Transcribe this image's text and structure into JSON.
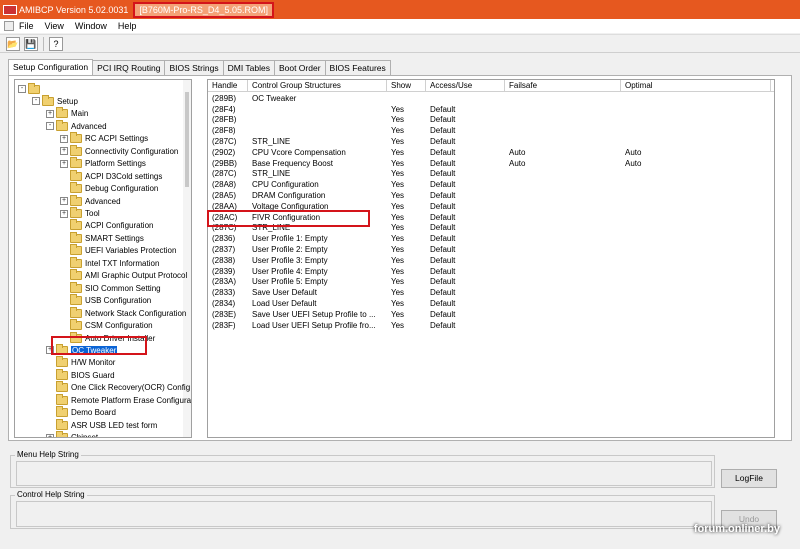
{
  "window": {
    "title": "AMIBCP Version 5.02.0031",
    "file": "[B760M-Pro-RS_D4_5.05.ROM]"
  },
  "menu": [
    "File",
    "View",
    "Window",
    "Help"
  ],
  "toolbar": {
    "icons": [
      "open-icon",
      "save-icon",
      "help-icon"
    ]
  },
  "tabs": [
    "Setup Configuration",
    "PCI IRQ Routing",
    "BIOS Strings",
    "DMI Tables",
    "Boot Order",
    "BIOS Features"
  ],
  "tree": [
    {
      "label": "",
      "level": 0,
      "expander": "-"
    },
    {
      "label": "Setup",
      "level": 1,
      "expander": "-"
    },
    {
      "label": "Main",
      "level": 2,
      "expander": "+"
    },
    {
      "label": "Advanced",
      "level": 2,
      "expander": "-"
    },
    {
      "label": "RC ACPI Settings",
      "level": 3,
      "expander": "+"
    },
    {
      "label": "Connectivity Configuration",
      "level": 3,
      "expander": "+"
    },
    {
      "label": "Platform Settings",
      "level": 3,
      "expander": "+"
    },
    {
      "label": "ACPI D3Cold settings",
      "level": 3,
      "expander": ""
    },
    {
      "label": "Debug Configuration",
      "level": 3,
      "expander": ""
    },
    {
      "label": "Advanced",
      "level": 3,
      "expander": "+"
    },
    {
      "label": "Tool",
      "level": 3,
      "expander": "+"
    },
    {
      "label": "ACPI Configuration",
      "level": 3,
      "expander": ""
    },
    {
      "label": "SMART Settings",
      "level": 3,
      "expander": ""
    },
    {
      "label": "UEFI Variables Protection",
      "level": 3,
      "expander": ""
    },
    {
      "label": "Intel TXT Information",
      "level": 3,
      "expander": ""
    },
    {
      "label": "AMI Graphic Output Protocol",
      "level": 3,
      "expander": ""
    },
    {
      "label": "SIO Common Setting",
      "level": 3,
      "expander": ""
    },
    {
      "label": "USB Configuration",
      "level": 3,
      "expander": ""
    },
    {
      "label": "Network Stack Configuration",
      "level": 3,
      "expander": ""
    },
    {
      "label": "CSM Configuration",
      "level": 3,
      "expander": ""
    },
    {
      "label": "Auto Driver Installer",
      "level": 3,
      "expander": ""
    },
    {
      "label": "OC Tweaker",
      "level": 2,
      "expander": "+",
      "selected": true
    },
    {
      "label": "H/W Monitor",
      "level": 2,
      "expander": ""
    },
    {
      "label": "BIOS Guard",
      "level": 2,
      "expander": ""
    },
    {
      "label": "One Click Recovery(OCR) Config",
      "level": 2,
      "expander": ""
    },
    {
      "label": "Remote Platform Erase Configuration",
      "level": 2,
      "expander": ""
    },
    {
      "label": "Demo Board",
      "level": 2,
      "expander": ""
    },
    {
      "label": "ASR USB LED test form",
      "level": 2,
      "expander": ""
    },
    {
      "label": "Chipset",
      "level": 2,
      "expander": "+"
    }
  ],
  "grid": {
    "columns": [
      "Handle",
      "Control Group Structures",
      "Show",
      "Access/Use",
      "Failsafe",
      "Optimal"
    ],
    "rows": [
      [
        "(289B)",
        "OC Tweaker",
        "",
        "",
        "",
        ""
      ],
      [
        "(28F4)",
        "",
        "Yes",
        "Default",
        "",
        ""
      ],
      [
        "(28FB)",
        "",
        "Yes",
        "Default",
        "",
        ""
      ],
      [
        "(28F8)",
        "",
        "Yes",
        "Default",
        "",
        ""
      ],
      [
        "(287C)",
        "STR_LINE",
        "Yes",
        "Default",
        "",
        ""
      ],
      [
        "(2902)",
        "CPU Vcore Compensation",
        "Yes",
        "Default",
        "Auto",
        "Auto"
      ],
      [
        "(29BB)",
        "Base Frequency Boost",
        "Yes",
        "Default",
        "Auto",
        "Auto"
      ],
      [
        "(287C)",
        "STR_LINE",
        "Yes",
        "Default",
        "",
        ""
      ],
      [
        "(28A8)",
        "CPU Configuration",
        "Yes",
        "Default",
        "",
        ""
      ],
      [
        "(28A5)",
        "DRAM Configuration",
        "Yes",
        "Default",
        "",
        ""
      ],
      [
        "(28AA)",
        "Voltage Configuration",
        "Yes",
        "Default",
        "",
        ""
      ],
      [
        "(28AC)",
        "FIVR Configuration",
        "Yes",
        "Default",
        "",
        ""
      ],
      [
        "(287C)",
        "STR_LINE",
        "Yes",
        "Default",
        "",
        ""
      ],
      [
        "(2836)",
        "User Profile 1: Empty",
        "Yes",
        "Default",
        "",
        ""
      ],
      [
        "(2837)",
        "User Profile 2: Empty",
        "Yes",
        "Default",
        "",
        ""
      ],
      [
        "(2838)",
        "User Profile 3: Empty",
        "Yes",
        "Default",
        "",
        ""
      ],
      [
        "(2839)",
        "User Profile 4: Empty",
        "Yes",
        "Default",
        "",
        ""
      ],
      [
        "(283A)",
        "User Profile 5: Empty",
        "Yes",
        "Default",
        "",
        ""
      ],
      [
        "(2833)",
        "Save User Default",
        "Yes",
        "Default",
        "",
        ""
      ],
      [
        "(2834)",
        "Load User Default",
        "Yes",
        "Default",
        "",
        ""
      ],
      [
        "(283E)",
        "Save User UEFI Setup Profile to ...",
        "Yes",
        "Default",
        "",
        ""
      ],
      [
        "(283F)",
        "Load User UEFI Setup Profile fro...",
        "Yes",
        "Default",
        "",
        ""
      ]
    ]
  },
  "menu_help": {
    "label": "Menu Help String"
  },
  "control_help": {
    "label": "Control Help String"
  },
  "buttons": {
    "logfile": "LogFile",
    "undo": "Undo"
  },
  "watermark": "forum.onliner.by",
  "colors": {
    "titlebar": "#e6581f",
    "selection": "#0a64d6",
    "highlight": "#d4141a"
  }
}
